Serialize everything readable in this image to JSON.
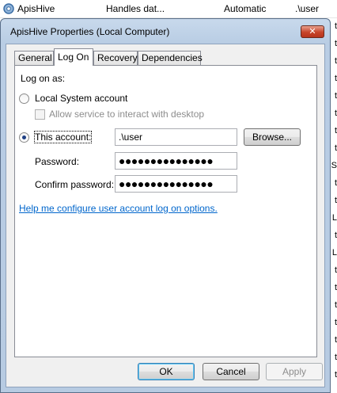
{
  "background": {
    "row": {
      "name": "ApisHive",
      "description": "Handles dat...",
      "startup_type": "Automatic",
      "log_on_as": ".\\user"
    },
    "right_edge_chars": [
      "t",
      "t",
      "t",
      "t",
      "t",
      "t",
      "t",
      "t",
      "S",
      "t",
      "t",
      "L",
      "t",
      "L",
      "t",
      "t",
      "t",
      "t",
      "t",
      "t",
      "t"
    ]
  },
  "dialog": {
    "title": "ApisHive Properties (Local Computer)",
    "close_glyph": "✕",
    "tabs": [
      {
        "label": "General"
      },
      {
        "label": "Log On",
        "active": true
      },
      {
        "label": "Recovery"
      },
      {
        "label": "Dependencies"
      }
    ],
    "logon": {
      "log_on_as_label": "Log on as:",
      "local_system_label": "Local System account",
      "allow_interact_label": "Allow service to interact with desktop",
      "this_account_label": "This account:",
      "account_value": ".\\user",
      "browse_label": "Browse...",
      "password_label": "Password:",
      "password_value": "●●●●●●●●●●●●●●●",
      "confirm_label": "Confirm password:",
      "confirm_value": "●●●●●●●●●●●●●●●",
      "help_link": "Help me configure user account log on options."
    },
    "buttons": {
      "ok": "OK",
      "cancel": "Cancel",
      "apply": "Apply"
    }
  }
}
